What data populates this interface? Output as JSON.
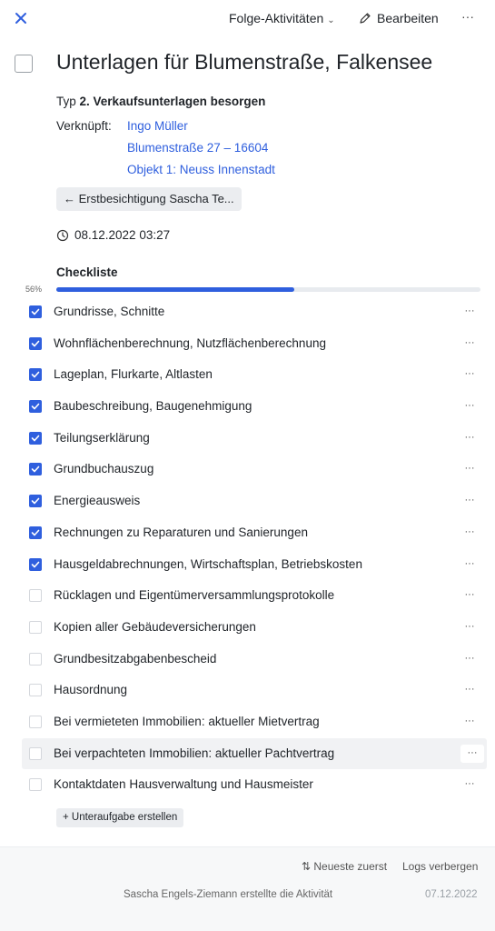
{
  "header": {
    "close_icon": "close-icon",
    "follow_label": "Folge-Aktivitäten",
    "edit_label": "Bearbeiten",
    "more_label": "···"
  },
  "activity": {
    "title": "Unterlagen für Blumenstraße, Falkensee",
    "type_prefix": "Typ",
    "type_value": "2. Verkaufsunterlagen besorgen",
    "linked_label": "Verknüpft:",
    "links": [
      "Ingo Müller",
      "Blumenstraße 27 – 16604",
      "Objekt 1: Neuss Innenstadt"
    ],
    "back_label": "← Erstbesichtigung Sascha Te...",
    "datetime": "08.12.2022 03:27"
  },
  "checklist": {
    "title": "Checkliste",
    "progress_label": "56%",
    "progress_value": 0.56,
    "items": [
      {
        "label": "Grundrisse, Schnitte",
        "checked": true
      },
      {
        "label": "Wohnflächenberechnung, Nutzflächenberechnung",
        "checked": true
      },
      {
        "label": "Lageplan, Flurkarte, Altlasten",
        "checked": true
      },
      {
        "label": "Baubeschreibung, Baugenehmigung",
        "checked": true
      },
      {
        "label": "Teilungserklärung",
        "checked": true
      },
      {
        "label": "Grundbuchauszug",
        "checked": true
      },
      {
        "label": "Energieausweis",
        "checked": true
      },
      {
        "label": "Rechnungen zu Reparaturen und Sanierungen",
        "checked": true
      },
      {
        "label": "Hausgeldabrechnungen, Wirtschaftsplan, Betriebskosten",
        "checked": true
      },
      {
        "label": "Rücklagen und Eigentümerversammlungsprotokolle",
        "checked": false
      },
      {
        "label": "Kopien aller Gebäudeversicherungen",
        "checked": false
      },
      {
        "label": "Grundbesitzabgabenbescheid",
        "checked": false
      },
      {
        "label": "Hausordnung",
        "checked": false
      },
      {
        "label": "Bei vermieteten Immobilien: aktueller Mietvertrag",
        "checked": false
      },
      {
        "label": "Bei verpachteten Immobilien: aktueller Pachtvertrag",
        "checked": false,
        "hover": true
      },
      {
        "label": "Kontaktdaten Hausverwaltung und Hausmeister",
        "checked": false
      }
    ],
    "item_more_label": "···",
    "add_label": "+ Unteraufgabe erstellen"
  },
  "footer": {
    "sort_label": "⇅ Neueste zuerst",
    "logs_label": "Logs verbergen",
    "log_text": "Sascha Engels-Ziemann erstellte die Aktivität",
    "log_date": "07.12.2022"
  },
  "colors": {
    "accent": "#2f5fde",
    "track": "#e8ebef"
  }
}
